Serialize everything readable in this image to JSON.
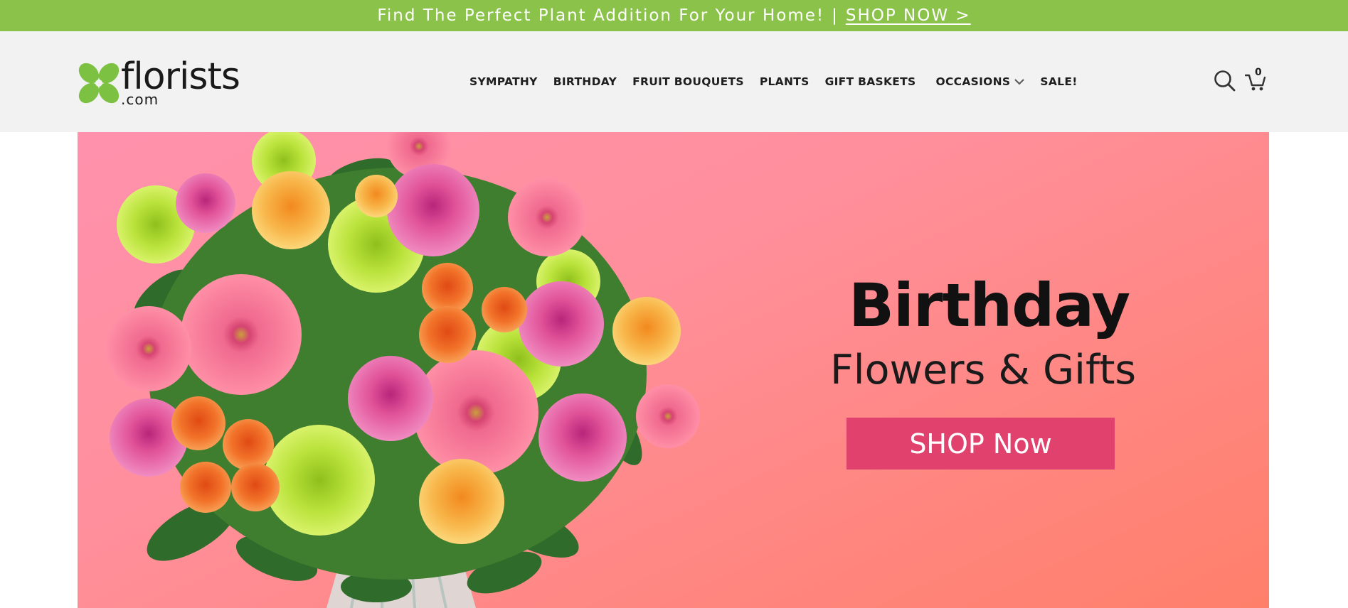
{
  "promo": {
    "message": "Find The Perfect Plant Addition For Your Home!",
    "separator": "|",
    "link_label": "SHOP NOW >"
  },
  "header": {
    "logo_word": "florists",
    "logo_tld": ".com",
    "nav": [
      "SYMPATHY",
      "BIRTHDAY",
      "FRUIT BOUQUETS",
      "PLANTS",
      "GIFT BASKETS",
      "OCCASIONS",
      "SALE!"
    ],
    "cart_count": "0"
  },
  "hero": {
    "title": "Birthday",
    "subtitle": "Flowers & Gifts",
    "cta_label": "SHOP Now"
  },
  "icons": {
    "logo_mark": "butterfly-leaf-icon",
    "search": "search-icon",
    "cart": "cart-icon",
    "dropdown": "chevron-down-icon"
  },
  "colors": {
    "promo_bg": "#8bc34a",
    "header_bg": "#f2f2f2",
    "logo_green": "#7cc142",
    "cta_bg": "#e0416d",
    "hero_pink": "#ff91ad",
    "hero_coral": "#ff7f6a"
  }
}
